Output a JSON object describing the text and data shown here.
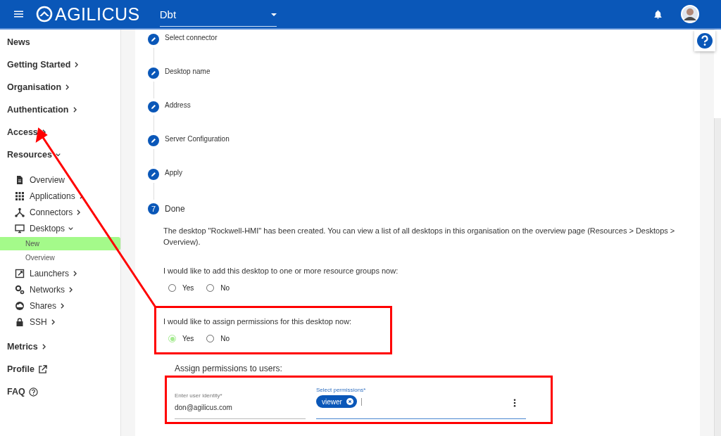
{
  "app_bar": {
    "logo": "AGILICUS",
    "organisation": "Dbt"
  },
  "sidebar": {
    "items": [
      {
        "label": "News",
        "kind": "plain"
      },
      {
        "label": "Getting Started",
        "kind": "collapsed"
      },
      {
        "label": "Organisation",
        "kind": "collapsed"
      },
      {
        "label": "Authentication",
        "kind": "collapsed"
      },
      {
        "label": "Access",
        "kind": "collapsed"
      },
      {
        "label": "Resources",
        "kind": "expanded",
        "children": [
          {
            "label": "Overview",
            "kind": "plain"
          },
          {
            "label": "Applications",
            "kind": "collapsed"
          },
          {
            "label": "Connectors",
            "kind": "collapsed"
          },
          {
            "label": "Desktops",
            "kind": "expanded",
            "children": [
              {
                "label": "New",
                "selected": true
              },
              {
                "label": "Overview",
                "selected": false
              }
            ]
          },
          {
            "label": "Launchers",
            "kind": "collapsed"
          },
          {
            "label": "Networks",
            "kind": "collapsed"
          },
          {
            "label": "Shares",
            "kind": "collapsed"
          },
          {
            "label": "SSH",
            "kind": "collapsed"
          }
        ]
      },
      {
        "label": "Metrics",
        "kind": "collapsed"
      },
      {
        "label": "Profile",
        "kind": "external"
      },
      {
        "label": "FAQ",
        "kind": "help"
      }
    ]
  },
  "stepper": {
    "steps": [
      {
        "label": "Select connector",
        "kind": "edit"
      },
      {
        "label": "Desktop name",
        "kind": "edit"
      },
      {
        "label": "Address",
        "kind": "edit"
      },
      {
        "label": "Server Configuration",
        "kind": "edit"
      },
      {
        "label": "Apply",
        "kind": "edit"
      },
      {
        "label": "Done",
        "kind": "number",
        "number": "7"
      }
    ]
  },
  "done": {
    "message": "The desktop \"Rockwell-HMI\" has been created. You can view a list of all desktops in this organisation on the overview page (Resources > Desktops > Overview).",
    "questions": [
      {
        "text": "I would like to add this desktop to one or more resource groups now:",
        "options": [
          {
            "label": "Yes",
            "selected": false
          },
          {
            "label": "No",
            "selected": false
          }
        ]
      },
      {
        "text": "I would like to assign permissions for this desktop now:",
        "options": [
          {
            "label": "Yes",
            "selected": true
          },
          {
            "label": "No",
            "selected": false
          }
        ]
      }
    ],
    "assign_title": "Assign permissions to users:",
    "user_field": {
      "label": "Enter user identity",
      "required_mark": "*",
      "value": "don@agilicus.com"
    },
    "permissions_field": {
      "label": "Select permissions",
      "required_mark": "*",
      "chips": [
        "viewer"
      ]
    }
  }
}
